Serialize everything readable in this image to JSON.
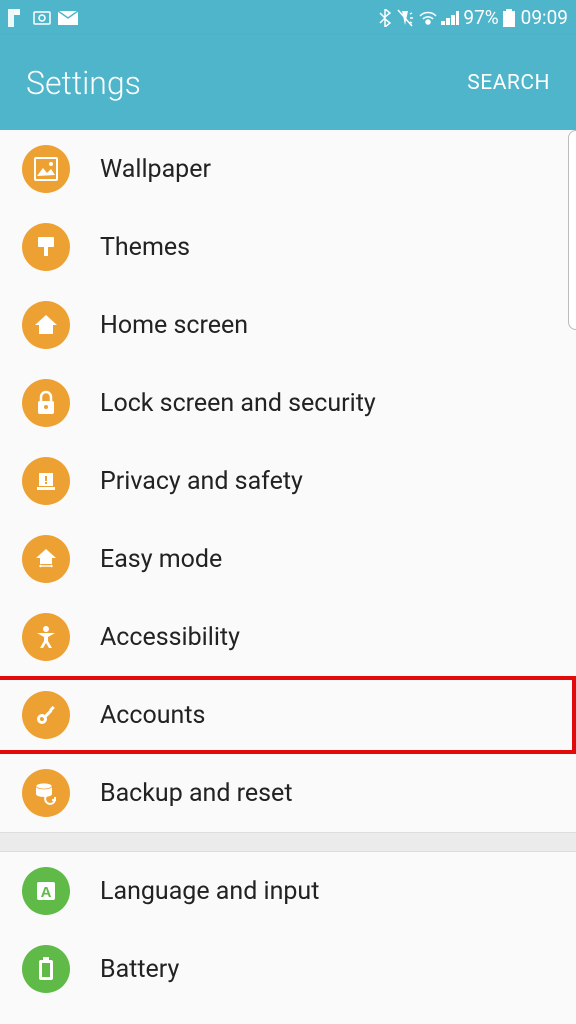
{
  "status_bar": {
    "battery_percent": "97%",
    "time": "09:09"
  },
  "header": {
    "title": "Settings",
    "search_label": "SEARCH"
  },
  "settings": {
    "items": [
      {
        "label": "Wallpaper",
        "icon": "image-icon",
        "color": "orange",
        "highlighted": false
      },
      {
        "label": "Themes",
        "icon": "brush-icon",
        "color": "orange",
        "highlighted": false
      },
      {
        "label": "Home screen",
        "icon": "home-icon",
        "color": "orange",
        "highlighted": false
      },
      {
        "label": "Lock screen and security",
        "icon": "lock-icon",
        "color": "orange",
        "highlighted": false
      },
      {
        "label": "Privacy and safety",
        "icon": "alert-icon",
        "color": "orange",
        "highlighted": false
      },
      {
        "label": "Easy mode",
        "icon": "home-arrows-icon",
        "color": "orange",
        "highlighted": false
      },
      {
        "label": "Accessibility",
        "icon": "person-icon",
        "color": "orange",
        "highlighted": false
      },
      {
        "label": "Accounts",
        "icon": "key-icon",
        "color": "orange",
        "highlighted": true
      },
      {
        "label": "Backup and reset",
        "icon": "backup-icon",
        "color": "orange",
        "highlighted": false
      }
    ],
    "items2": [
      {
        "label": "Language and input",
        "icon": "letter-a-icon",
        "color": "green",
        "highlighted": false
      },
      {
        "label": "Battery",
        "icon": "battery-icon",
        "color": "green",
        "highlighted": false
      }
    ]
  }
}
